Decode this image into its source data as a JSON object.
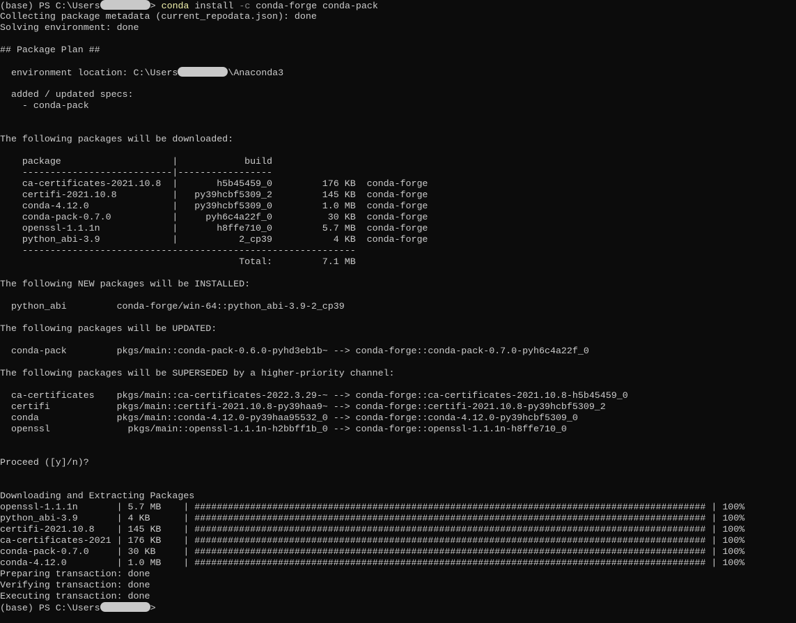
{
  "terminal": {
    "prompt_prefix": "(base) PS C:\\Users",
    "prompt_suffix": ">",
    "command_name": "conda",
    "command_args_1": " install ",
    "command_flag": "-c",
    "command_args_2": " conda-forge conda-pack",
    "lines": [
      "Collecting package metadata (current_repodata.json): done",
      "Solving environment: done",
      "",
      "## Package Plan ##",
      ""
    ],
    "env_location_prefix": "  environment location: C:\\Users",
    "env_location_suffix": "\\Anaconda3",
    "lines2": [
      "",
      "  added / updated specs:",
      "    - conda-pack",
      "",
      "",
      "The following packages will be downloaded:",
      "",
      "    package                    |            build",
      "    ---------------------------|-----------------",
      "    ca-certificates-2021.10.8  |       h5b45459_0         176 KB  conda-forge",
      "    certifi-2021.10.8          |   py39hcbf5309_2         145 KB  conda-forge",
      "    conda-4.12.0               |   py39hcbf5309_0         1.0 MB  conda-forge",
      "    conda-pack-0.7.0           |     pyh6c4a22f_0          30 KB  conda-forge",
      "    openssl-1.1.1n             |       h8ffe710_0         5.7 MB  conda-forge",
      "    python_abi-3.9             |           2_cp39           4 KB  conda-forge",
      "    ------------------------------------------------------------",
      "                                           Total:         7.1 MB",
      "",
      "The following NEW packages will be INSTALLED:",
      "",
      "  python_abi         conda-forge/win-64::python_abi-3.9-2_cp39",
      "",
      "The following packages will be UPDATED:",
      "",
      "  conda-pack         pkgs/main::conda-pack-0.6.0-pyhd3eb1b~ --> conda-forge::conda-pack-0.7.0-pyh6c4a22f_0",
      "",
      "The following packages will be SUPERSEDED by a higher-priority channel:",
      "",
      "  ca-certificates    pkgs/main::ca-certificates-2022.3.29-~ --> conda-forge::ca-certificates-2021.10.8-h5b45459_0",
      "  certifi            pkgs/main::certifi-2021.10.8-py39haa9~ --> conda-forge::certifi-2021.10.8-py39hcbf5309_2",
      "  conda              pkgs/main::conda-4.12.0-py39haa95532_0 --> conda-forge::conda-4.12.0-py39hcbf5309_0",
      "  openssl              pkgs/main::openssl-1.1.1n-h2bbff1b_0 --> conda-forge::openssl-1.1.1n-h8ffe710_0",
      "",
      "",
      "Proceed ([y]/n)?",
      "",
      "",
      "Downloading and Extracting Packages",
      "openssl-1.1.1n       | 5.7 MB    | ############################################################################################ | 100%",
      "python_abi-3.9       | 4 KB      | ############################################################################################ | 100%",
      "certifi-2021.10.8    | 145 KB    | ############################################################################################ | 100%",
      "ca-certificates-2021 | 176 KB    | ############################################################################################ | 100%",
      "conda-pack-0.7.0     | 30 KB     | ############################################################################################ | 100%",
      "conda-4.12.0         | 1.0 MB    | ############################################################################################ | 100%",
      "Preparing transaction: done",
      "Verifying transaction: done",
      "Executing transaction: done"
    ]
  },
  "colors": {
    "background": "#0c0c0c",
    "text": "#cccccc",
    "command": "#f2f2ac",
    "flag": "#8a8a8a",
    "redaction": "#c9c9c9"
  }
}
